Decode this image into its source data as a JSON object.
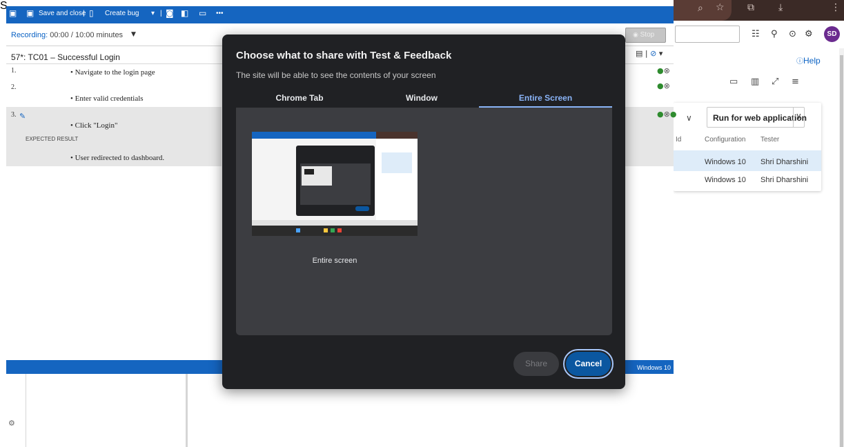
{
  "runner": {
    "toolbar": {
      "save_and_close": "Save and close",
      "create_bug": "Create bug"
    },
    "recording_label": "Recording:",
    "recording_time": "00:00 / 10:00 minutes",
    "stop_label": "Stop",
    "test_case_title": "57*: TC01 – Successful Login",
    "steps": [
      {
        "number": "1.",
        "action": "Navigate to the login page"
      },
      {
        "number": "2.",
        "action": "Enter valid credentials"
      },
      {
        "number": "3.",
        "action": "Click \"Login\"",
        "expected_label": "EXPECTED RESULT",
        "expected": "User redirected to dashboard."
      }
    ],
    "footer_text": "Windows 10"
  },
  "dialog": {
    "title": "Choose what to share with Test & Feedback",
    "subtitle": "The site will be able to see the contents of your screen",
    "tabs": [
      {
        "label": "Chrome Tab",
        "active": false
      },
      {
        "label": "Window",
        "active": false
      },
      {
        "label": "Entire Screen",
        "active": true
      }
    ],
    "source_label": "Entire screen",
    "share_label": "Share",
    "cancel_label": "Cancel"
  },
  "ado": {
    "help_label": "Help",
    "user_initials": "SD",
    "profile_initial": "S",
    "run_button_label": "Run for web application",
    "columns": {
      "id": "Id",
      "configuration": "Configuration",
      "tester": "Tester"
    },
    "rows": [
      {
        "configuration": "Windows 10",
        "tester": "Shri Dharshini",
        "selected": true
      },
      {
        "configuration": "Windows 10",
        "tester": "Shri Dharshini",
        "selected": false
      }
    ]
  },
  "colors": {
    "runner_blue": "#1565c0",
    "dialog_bg": "#202124",
    "accent_blue": "#8ab4f8",
    "cancel_blue": "#0b57a0",
    "pass_green": "#2e8b2e"
  }
}
